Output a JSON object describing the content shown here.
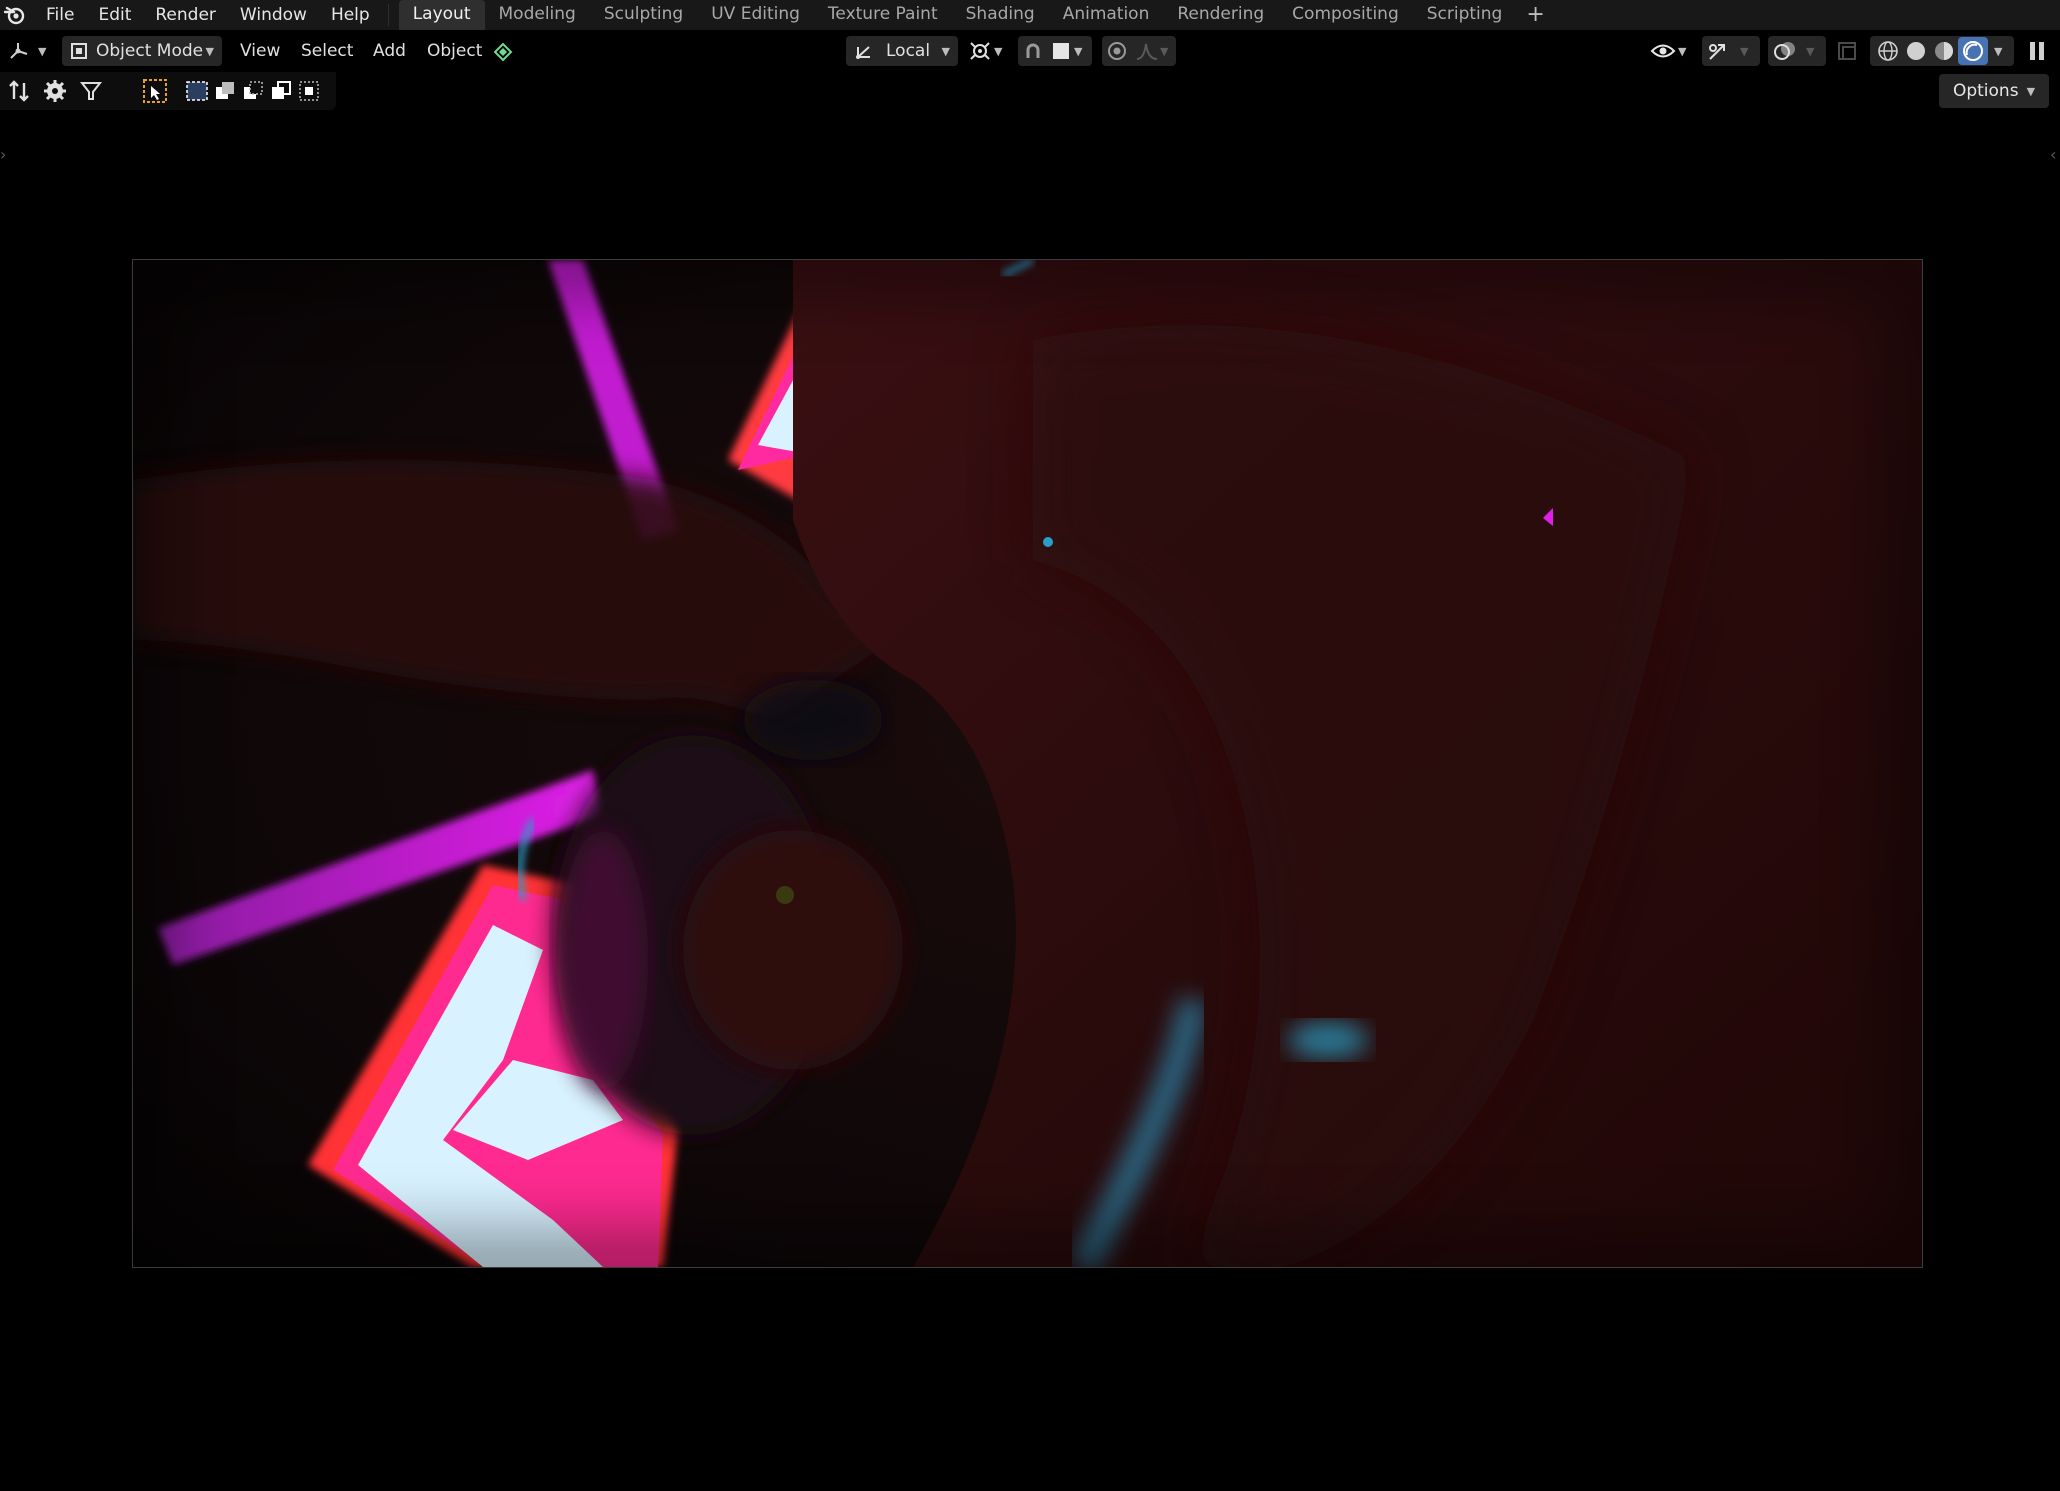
{
  "app": {
    "name": "Blender"
  },
  "menu": {
    "file": "File",
    "edit": "Edit",
    "render": "Render",
    "window": "Window",
    "help": "Help"
  },
  "workspaces": [
    {
      "label": "Layout",
      "active": true
    },
    {
      "label": "Modeling"
    },
    {
      "label": "Sculpting"
    },
    {
      "label": "UV Editing"
    },
    {
      "label": "Texture Paint"
    },
    {
      "label": "Shading"
    },
    {
      "label": "Animation"
    },
    {
      "label": "Rendering"
    },
    {
      "label": "Compositing"
    },
    {
      "label": "Scripting"
    }
  ],
  "header": {
    "mode": "Object Mode",
    "view": "View",
    "select": "Select",
    "add": "Add",
    "object": "Object",
    "transform_orientation": "Local",
    "options": "Options"
  },
  "icons": {
    "logo": "blender-logo-icon",
    "editor_type": "3d-viewport-editor-icon",
    "orientation": "transform-orientation-icon",
    "pivot": "pivot-point-icon",
    "snap": "snap-magnet-icon",
    "proportional": "proportional-editing-icon",
    "visibility": "eye-visibility-icon",
    "gizmo": "gizmo-icon",
    "overlays": "overlays-icon",
    "xray": "xray-icon",
    "shading": [
      "wireframe-shading-icon",
      "solid-shading-icon",
      "material-preview-icon",
      "rendered-shading-icon"
    ]
  },
  "colors": {
    "accent": "#4772b3",
    "neon_pink": "#e020e8",
    "neon_red": "#ff3050",
    "ice_white": "#d8f2ff",
    "cyan": "#2a9ec8"
  }
}
